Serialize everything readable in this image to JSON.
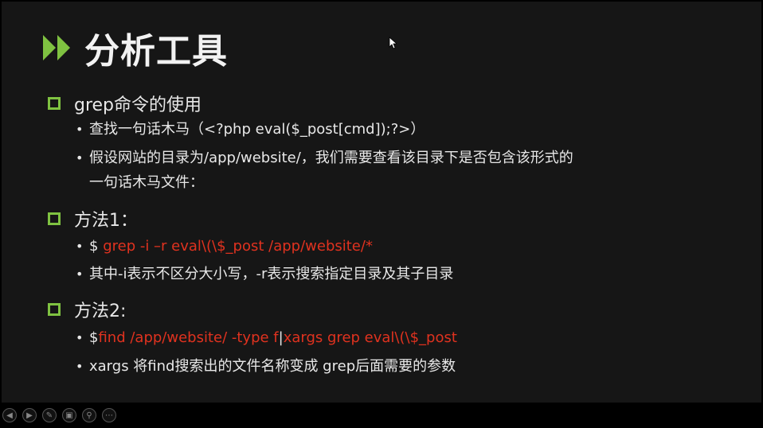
{
  "slide": {
    "title": "分析工具",
    "sections": [
      {
        "heading": "grep命令的使用",
        "bullets": [
          "查找一句话木马（<?php eval($_post[cmd]);?>）",
          "假设网站的目录为/app/website/，我们需要查看该目录下是否包含该形式的",
          "一句话木马文件："
        ]
      },
      {
        "heading": "方法1：",
        "cmd1_prefix": "$ ",
        "cmd1_red": "grep -i –r eval\\(\\$_post /app/website/*",
        "note": "其中-i表示不区分大小写，-r表示搜索指定目录及其子目录"
      },
      {
        "heading": "方法2:",
        "cmd2_prefix": "$",
        "cmd2_red_a": "find /app/website/ -type f",
        "cmd2_mid": "|",
        "cmd2_red_b": "xargs grep eval\\(\\$_post",
        "note": "xargs 将find搜索出的文件名称变成 grep后面需要的参数"
      }
    ]
  },
  "controls": [
    "prev-icon",
    "next-icon",
    "pen-icon",
    "slides-icon",
    "zoom-icon",
    "more-icon"
  ],
  "colors": {
    "accent": "#7fc241",
    "command": "#e0321f",
    "background": "#161616"
  }
}
